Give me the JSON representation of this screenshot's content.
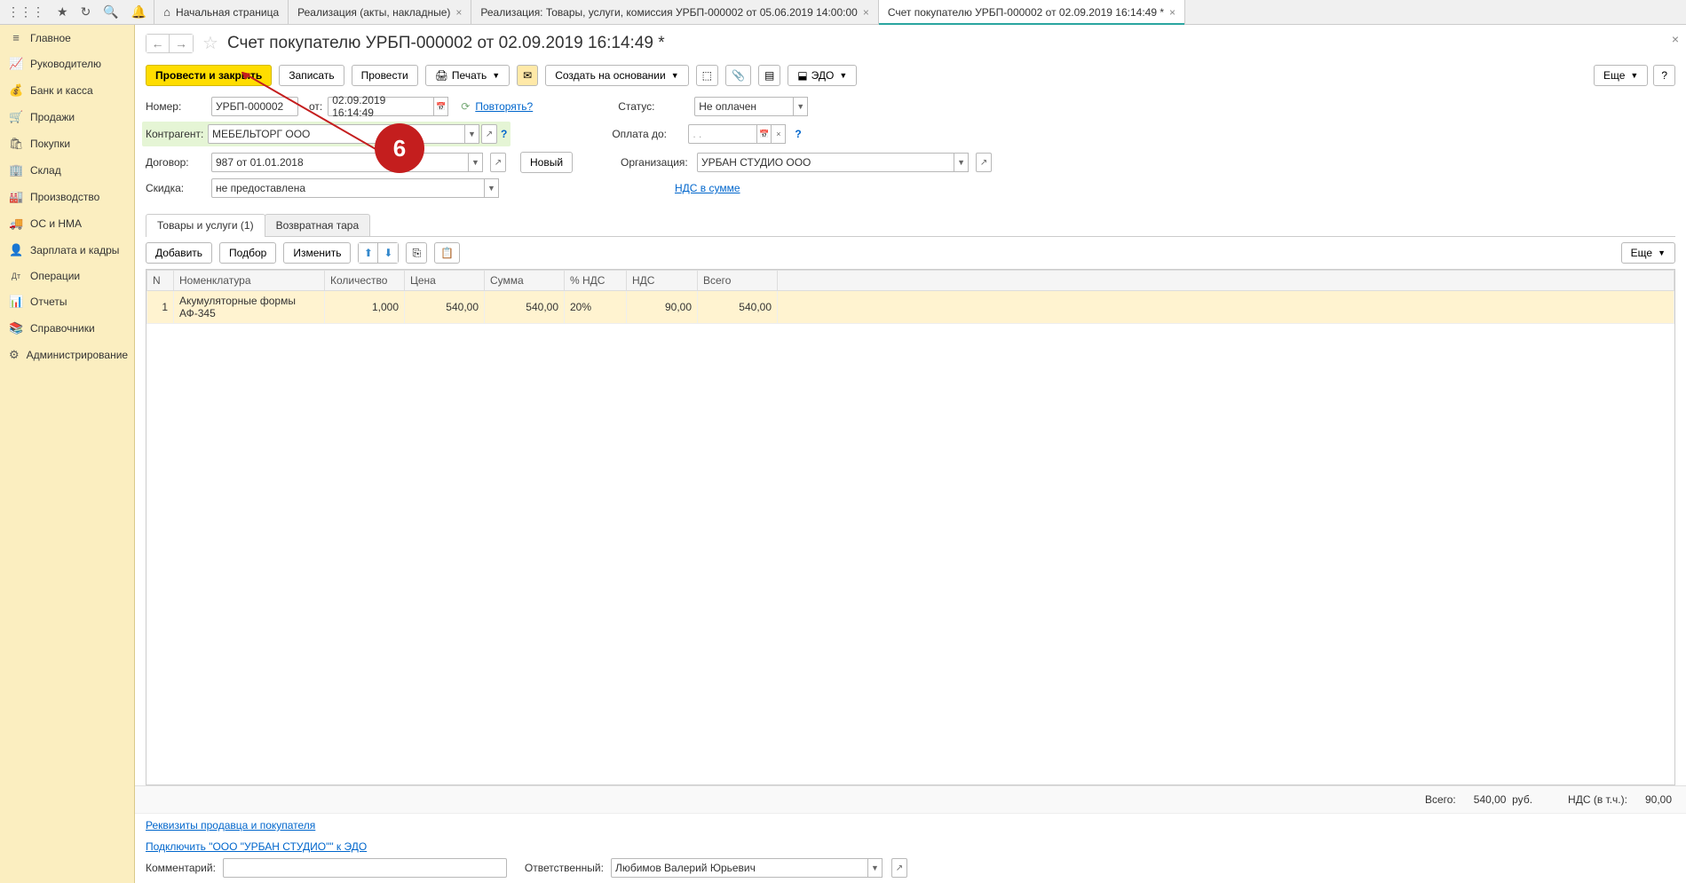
{
  "tabs": [
    {
      "label": "Начальная страница",
      "closable": false,
      "home": true
    },
    {
      "label": "Реализация (акты, накладные)",
      "closable": true
    },
    {
      "label": "Реализация: Товары, услуги, комиссия УРБП-000002 от 05.06.2019 14:00:00",
      "closable": true
    },
    {
      "label": "Счет покупателю УРБП-000002 от 02.09.2019 16:14:49 *",
      "closable": true,
      "active": true
    }
  ],
  "sidebar": [
    {
      "icon": "≡",
      "label": "Главное"
    },
    {
      "icon": "📈",
      "label": "Руководителю"
    },
    {
      "icon": "💰",
      "label": "Банк и касса"
    },
    {
      "icon": "🛒",
      "label": "Продажи"
    },
    {
      "icon": "🛍",
      "label": "Покупки"
    },
    {
      "icon": "🏢",
      "label": "Склад"
    },
    {
      "icon": "🏭",
      "label": "Производство"
    },
    {
      "icon": "🚚",
      "label": "ОС и НМА"
    },
    {
      "icon": "👤",
      "label": "Зарплата и кадры"
    },
    {
      "icon": "Дт",
      "label": "Операции"
    },
    {
      "icon": "📊",
      "label": "Отчеты"
    },
    {
      "icon": "📚",
      "label": "Справочники"
    },
    {
      "icon": "⚙",
      "label": "Администрирование"
    }
  ],
  "page": {
    "title": "Счет покупателю УРБП-000002 от 02.09.2019 16:14:49 *"
  },
  "toolbar": {
    "post_close": "Провести и закрыть",
    "write": "Записать",
    "post": "Провести",
    "print": "Печать",
    "create_based": "Создать на основании",
    "edo": "ЭДО",
    "more": "Еще",
    "help": "?"
  },
  "form": {
    "number_label": "Номер:",
    "number_value": "УРБП-000002",
    "date_label": "от:",
    "date_value": "02.09.2019 16:14:49",
    "repeat_link": "Повторять?",
    "status_label": "Статус:",
    "status_value": "Не оплачен",
    "counterparty_label": "Контрагент:",
    "counterparty_value": "МЕБЕЛЬТОРГ ООО",
    "payment_due_label": "Оплата до:",
    "payment_due_value": ". .",
    "contract_label": "Договор:",
    "contract_value": "987 от 01.01.2018",
    "new_btn": "Новый",
    "org_label": "Организация:",
    "org_value": "УРБАН СТУДИО ООО",
    "discount_label": "Скидка:",
    "discount_value": "не предоставлена",
    "vat_link": "НДС в сумме"
  },
  "sub_tabs": {
    "goods": "Товары и услуги (1)",
    "containers": "Возвратная тара"
  },
  "table_toolbar": {
    "add": "Добавить",
    "pick": "Подбор",
    "edit": "Изменить",
    "more": "Еще"
  },
  "table": {
    "headers": {
      "n": "N",
      "nomenclature": "Номенклатура",
      "quantity": "Количество",
      "price": "Цена",
      "sum": "Сумма",
      "vat_rate": "% НДС",
      "vat": "НДС",
      "total": "Всего"
    },
    "rows": [
      {
        "n": "1",
        "nomenclature": "Акумуляторные формы АФ-345",
        "quantity": "1,000",
        "price": "540,00",
        "sum": "540,00",
        "vat_rate": "20%",
        "vat": "90,00",
        "total": "540,00"
      }
    ]
  },
  "footer": {
    "total_label": "Всего:",
    "total_value": "540,00",
    "currency": "руб.",
    "vat_label": "НДС (в т.ч.):",
    "vat_value": "90,00",
    "details_link": "Реквизиты продавца и покупателя",
    "edo_link": "Подключить \"ООО \"УРБАН СТУДИО\"\" к ЭДО",
    "comment_label": "Комментарий:",
    "responsible_label": "Ответственный:",
    "responsible_value": "Любимов Валерий Юрьевич"
  },
  "annotation": {
    "number": "6"
  }
}
